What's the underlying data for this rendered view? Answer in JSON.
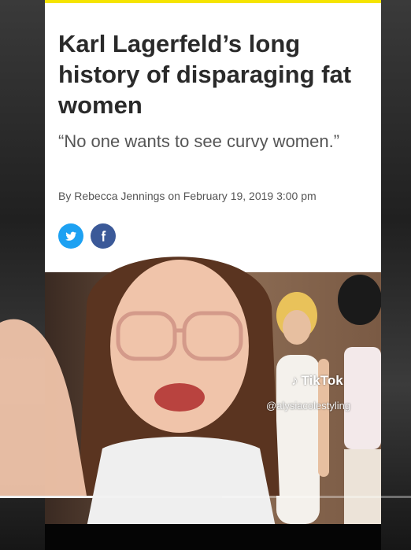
{
  "article": {
    "headline": "Karl Lagerfeld’s long history of disparaging fat women",
    "subhead": "“No one wants to see curvy women.”",
    "byline_prefix": "By",
    "author": "Rebecca Jennings",
    "byline_mid": "on",
    "date": "February 19, 2019 3:00 pm",
    "share_icons": [
      "twitter-icon",
      "facebook-icon"
    ]
  },
  "overlay": {
    "brand": "TikTok",
    "handle": "@alysiacolestyling",
    "progress": 0.54
  },
  "colors": {
    "accent_bar": "#f5e400",
    "twitter": "#1da1f2",
    "facebook": "#3b5998"
  }
}
